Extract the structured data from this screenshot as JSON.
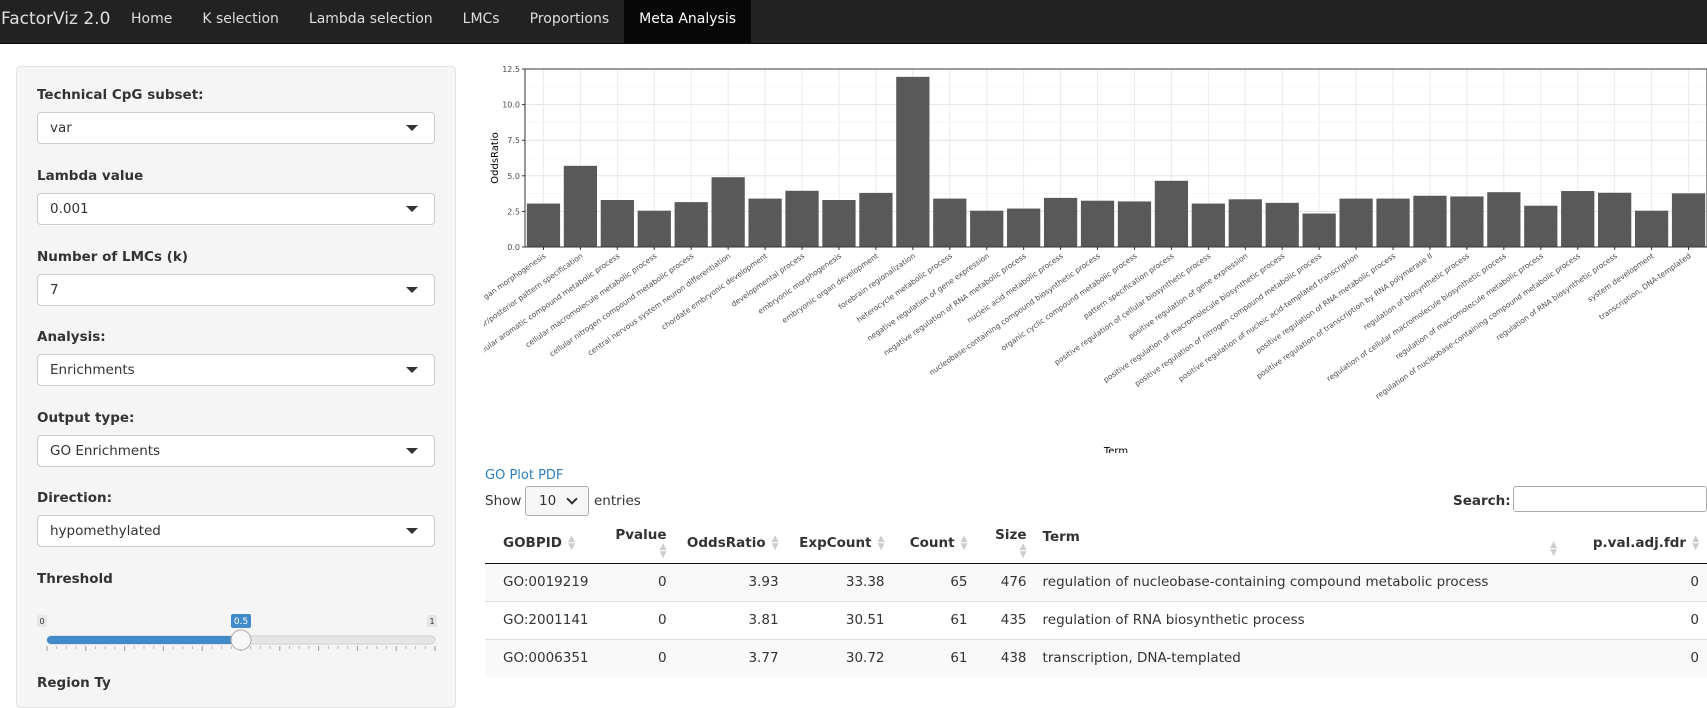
{
  "navbar": {
    "brand": "FactorViz 2.0",
    "items": [
      {
        "label": "Home",
        "active": false
      },
      {
        "label": "K selection",
        "active": false
      },
      {
        "label": "Lambda selection",
        "active": false
      },
      {
        "label": "LMCs",
        "active": false
      },
      {
        "label": "Proportions",
        "active": false
      },
      {
        "label": "Meta Analysis",
        "active": true
      }
    ]
  },
  "sidebar": {
    "cpg_label": "Technical CpG subset:",
    "cpg_value": "var",
    "lambda_label": "Lambda value",
    "lambda_value": "0.001",
    "k_label": "Number of LMCs (k)",
    "k_value": "7",
    "analysis_label": "Analysis:",
    "analysis_value": "Enrichments",
    "output_label": "Output type:",
    "output_value": "GO Enrichments",
    "direction_label": "Direction:",
    "direction_value": "hypomethylated",
    "threshold_label": "Threshold",
    "threshold": {
      "min": "0",
      "max": "1",
      "value": "0.5",
      "fraction": 0.5,
      "ticks": [
        "0",
        "0.1",
        "0.2",
        "0.3",
        "0.4",
        "0.5",
        "0.6",
        "0.7",
        "0.8",
        "0.9",
        "1"
      ]
    },
    "next_label": "Region Ty"
  },
  "chart_data": {
    "type": "bar",
    "xlabel": "Term",
    "ylabel": "OddsRatio",
    "ylim": [
      0,
      12.5
    ],
    "yticks": [
      "0.0",
      "2.5",
      "5.0",
      "7.5",
      "10.0",
      "12.5"
    ],
    "grid": true,
    "categories": [
      "animal organ morphogenesis",
      "anterior/posterior pattern specification",
      "cellular aromatic compound metabolic process",
      "cellular macromolecule metabolic process",
      "cellular nitrogen compound metabolic process",
      "central nervous system neuron differentiation",
      "chordate embryonic development",
      "developmental process",
      "embryonic morphogenesis",
      "embryonic organ development",
      "forebrain regionalization",
      "heterocycle metabolic process",
      "negative regulation of gene expression",
      "negative regulation of RNA metabolic process",
      "nucleic acid metabolic process",
      "nucleobase-containing compound biosynthetic process",
      "organic cyclic compound metabolic process",
      "pattern specification process",
      "positive regulation of cellular biosynthetic process",
      "positive regulation of gene expression",
      "positive regulation of macromolecule biosynthetic process",
      "positive regulation of nitrogen compound metabolic process",
      "positive regulation of nucleic acid-templated transcription",
      "positive regulation of RNA metabolic process",
      "positive regulation of transcription by RNA polymerase II",
      "regulation of biosynthetic process",
      "regulation of cellular macromolecule biosynthetic process",
      "regulation of macromolecule metabolic process",
      "regulation of nucleobase-containing compound metabolic process",
      "regulation of RNA biosynthetic process",
      "system development",
      "transcription, DNA-templated"
    ],
    "values": [
      3.05,
      5.7,
      3.3,
      2.55,
      3.15,
      4.9,
      3.4,
      3.95,
      3.3,
      3.8,
      11.95,
      3.4,
      2.55,
      2.7,
      3.45,
      3.25,
      3.2,
      4.65,
      3.05,
      3.35,
      3.1,
      2.35,
      3.4,
      3.4,
      3.6,
      3.55,
      3.85,
      2.9,
      3.93,
      3.81,
      2.55,
      3.77
    ]
  },
  "main": {
    "pdf_link": "GO Plot PDF",
    "show_label": "Show",
    "page_length": "10",
    "entries_label": "entries",
    "search_label": "Search:",
    "columns": [
      "GOBPID",
      "Pvalue",
      "OddsRatio",
      "ExpCount",
      "Count",
      "Size",
      "Term",
      "p.val.adj.fdr"
    ],
    "rows": [
      [
        "GO:0019219",
        "0",
        "3.93",
        "33.38",
        "65",
        "476",
        "regulation of nucleobase-containing compound metabolic process",
        "0"
      ],
      [
        "GO:2001141",
        "0",
        "3.81",
        "30.51",
        "61",
        "435",
        "regulation of RNA biosynthetic process",
        "0"
      ],
      [
        "GO:0006351",
        "0",
        "3.77",
        "30.72",
        "61",
        "438",
        "transcription, DNA-templated",
        "0"
      ]
    ]
  }
}
